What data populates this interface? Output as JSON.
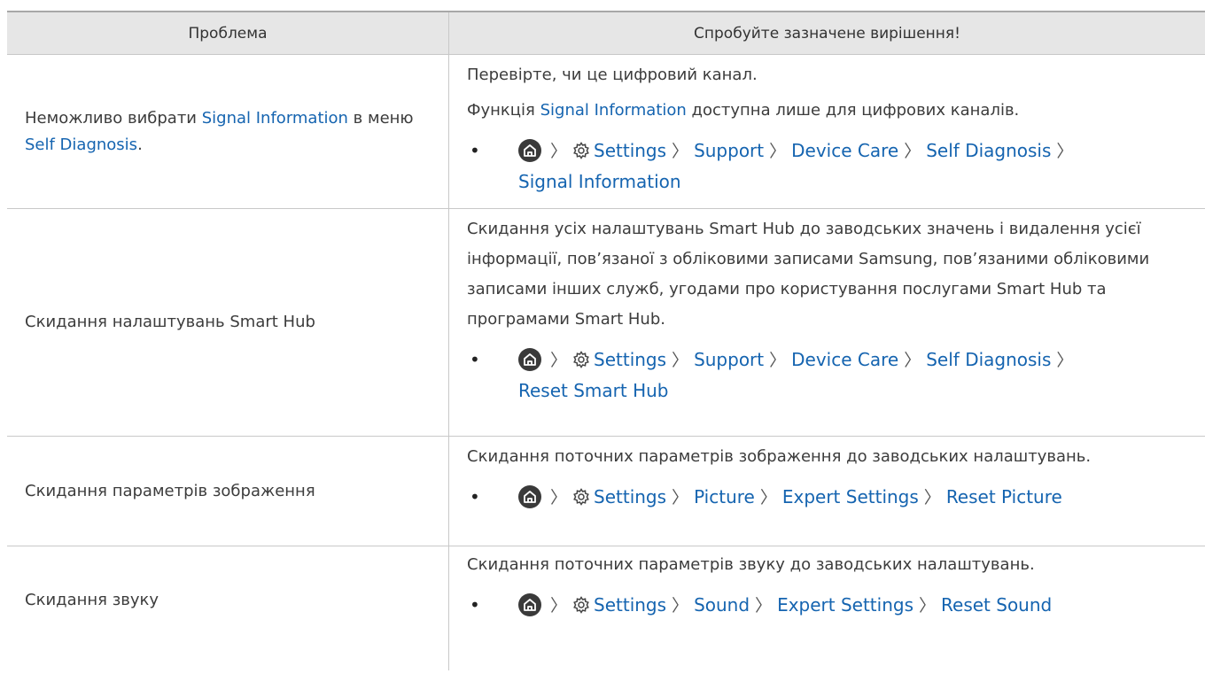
{
  "header": {
    "col1": "Проблема",
    "col2": "Спробуйте зазначене вирішення!"
  },
  "rows": [
    {
      "problem": {
        "pre": "Неможливо вибрати ",
        "hl1": "Signal Information",
        "mid": " в меню ",
        "hl2": "Self Diagnosis",
        "post": "."
      },
      "para1": "Перевірте, чи це цифровий канал.",
      "para2": {
        "pre": "Функція ",
        "hl": "Signal Information",
        "post": " доступна лише для цифрових каналів."
      },
      "path": [
        "Settings",
        "Support",
        "Device Care",
        "Self Diagnosis",
        "Signal Information"
      ]
    },
    {
      "problem": "Скидання налаштувань Smart Hub",
      "para1": "Скидання усіх налаштувань Smart Hub до заводських значень і видалення усієї інформації, пов’язаної з обліковими записами Samsung, пов’язаними обліковими записами інших служб, угодами про користування послугами Smart Hub та програмами Smart Hub.",
      "path": [
        "Settings",
        "Support",
        "Device Care",
        "Self Diagnosis",
        "Reset Smart Hub"
      ]
    },
    {
      "problem": "Скидання параметрів зображення",
      "para1": "Скидання поточних параметрів зображення до заводських налаштувань.",
      "path": [
        "Settings",
        "Picture",
        "Expert Settings",
        "Reset Picture"
      ]
    },
    {
      "problem": "Скидання звуку",
      "para1": "Скидання поточних параметрів звуку до заводських налаштувань.",
      "path": [
        "Settings",
        "Sound",
        "Expert Settings",
        "Reset Sound"
      ]
    }
  ],
  "icons": {
    "home": "home-icon",
    "settings": "gear-icon",
    "separator": "chevron-right-icon"
  },
  "colors": {
    "link": "#1564b0",
    "header_bg": "#e6e6e6",
    "text": "#3c3c3c"
  },
  "glyphs": {
    "bullet": "•",
    "sep": "〉"
  }
}
